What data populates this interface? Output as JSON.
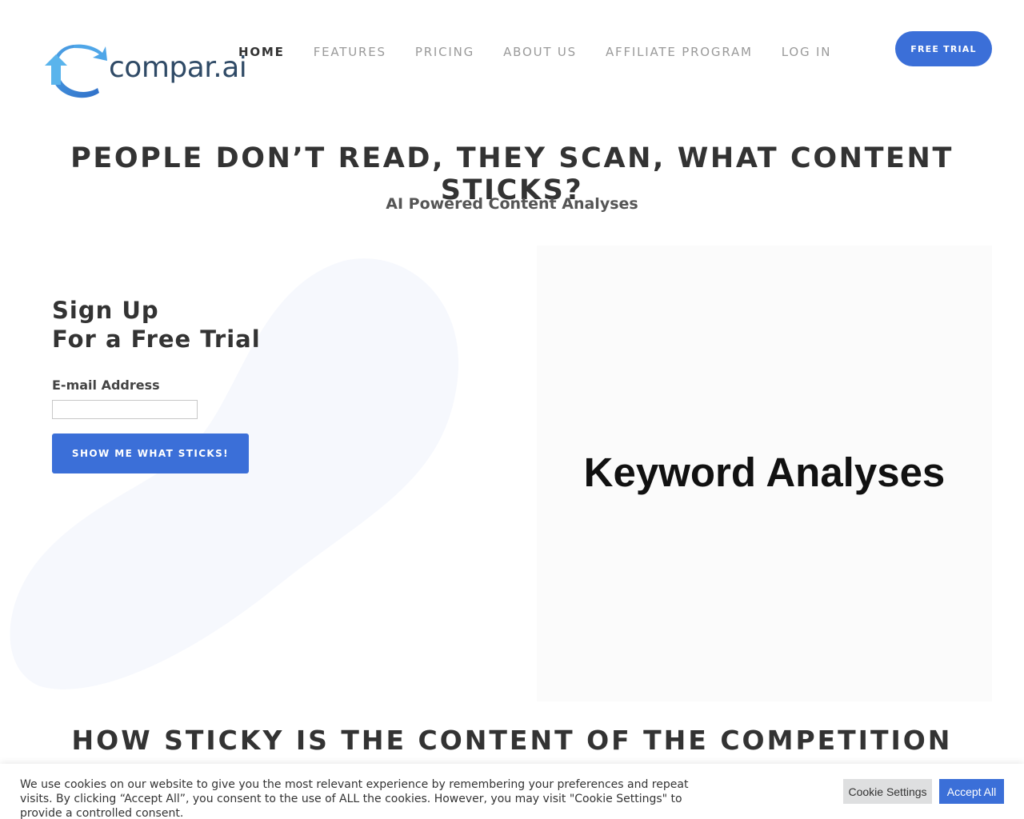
{
  "brand": {
    "name": "compar",
    "suffix": ".ai",
    "accent": "#3b6fd8"
  },
  "nav": {
    "items": [
      {
        "label": "HOME",
        "active": true
      },
      {
        "label": "FEATURES",
        "active": false
      },
      {
        "label": "PRICING",
        "active": false
      },
      {
        "label": "ABOUT US",
        "active": false
      },
      {
        "label": "AFFILIATE PROGRAM",
        "active": false
      },
      {
        "label": "LOG IN",
        "active": false
      }
    ],
    "cta_label": "FREE TRIAL"
  },
  "hero": {
    "title": "PEOPLE DON’T READ, THEY SCAN, WHAT CONTENT STICKS?",
    "subtitle": "AI Powered Content Analyses"
  },
  "signup": {
    "title_line1": "Sign Up",
    "title_line2": "For a Free Trial",
    "email_label": "E-mail Address",
    "email_value": "",
    "submit_label": "SHOW ME WHAT STICKS!"
  },
  "feature_panel": {
    "text": "Keyword Analyses"
  },
  "section": {
    "title": "HOW STICKY IS THE CONTENT OF THE COMPETITION"
  },
  "cookie": {
    "text": "We use cookies on our website to give you the most relevant experience by remembering your preferences and repeat visits. By clicking “Accept All”, you consent to the use of ALL the cookies. However, you may visit \"Cookie Settings\" to provide a controlled consent.",
    "settings_label": "Cookie Settings",
    "accept_label": "Accept All"
  }
}
